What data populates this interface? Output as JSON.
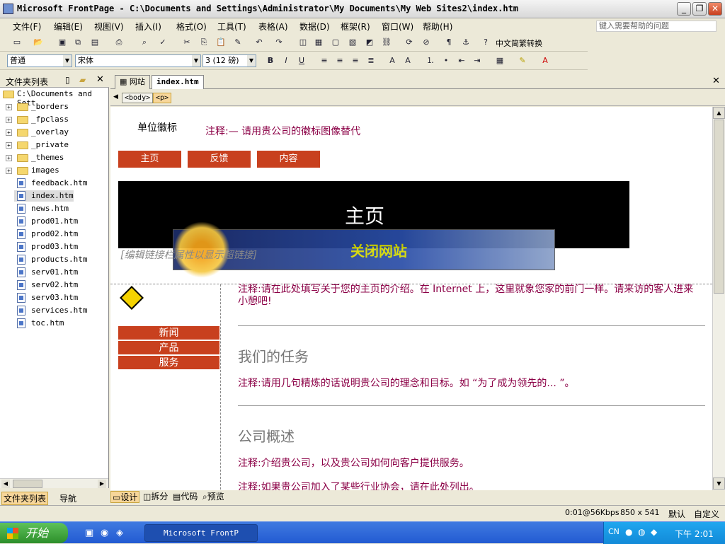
{
  "window": {
    "title": "Microsoft FrontPage - C:\\Documents and Settings\\Administrator\\My Documents\\My Web Sites2\\index.htm"
  },
  "menu": {
    "items": [
      "文件(F)",
      "编辑(E)",
      "视图(V)",
      "插入(I)",
      "格式(O)",
      "工具(T)",
      "表格(A)",
      "数据(D)",
      "框架(R)",
      "窗口(W)",
      "帮助(H)"
    ],
    "help_placeholder": "键入需要帮助的问题"
  },
  "toolbar": {
    "convert_label": "中文简繁转换"
  },
  "formatting": {
    "style": "普通",
    "font": "宋体",
    "size": "3 (12 磅)"
  },
  "folder_panel": {
    "title": "文件夹列表",
    "root": "C:\\Documents and Sett",
    "folders": [
      "_borders",
      "_fpclass",
      "_overlay",
      "_private",
      "_themes",
      "images"
    ],
    "files": [
      "feedback.htm",
      "index.htm",
      "news.htm",
      "prod01.htm",
      "prod02.htm",
      "prod03.htm",
      "products.htm",
      "serv01.htm",
      "serv02.htm",
      "serv03.htm",
      "services.htm",
      "toc.htm"
    ],
    "bottom_tabs": [
      "文件夹列表",
      "导航"
    ]
  },
  "doc_tabs": [
    "网站",
    "index.htm"
  ],
  "breadcrumb": [
    "<body>",
    "<p>"
  ],
  "page": {
    "logo_label": "单位徽标",
    "logo_note": "注释:— 请用贵公司的徽标图像替代",
    "top_nav": [
      "主页",
      "反馈",
      "内容"
    ],
    "banner_title": "主页",
    "overlay_text": "关闭网站",
    "edit_link_hint": "[编辑链接栏属性以显示超链接]",
    "side_nav": [
      "新闻",
      "产品",
      "服务"
    ],
    "intro_note": "注释:请在此处填写关于您的主页的介绍。在 Internet 上，这里就象您家的前门一样。请来访的客人进来小憩吧!",
    "section1_heading": "我们的任务",
    "section1_note": "注释:请用几句精炼的话说明贵公司的理念和目标。如 “为了成为领先的... ”。",
    "section2_heading": "公司概述",
    "section2_note1": "注释:介绍贵公司，以及贵公司如何向客户提供服务。",
    "section2_note2": "注释:如果贵公司加入了某些行业协会，请在此处列出。"
  },
  "view_tabs": [
    "设计",
    "拆分",
    "代码",
    "预览"
  ],
  "status": {
    "speed": "0:01@56Kbps",
    "dimensions": "850 x 541",
    "mode1": "默认",
    "mode2": "自定义"
  },
  "taskbar": {
    "start_label": "开始",
    "task_label": "Microsoft FrontP",
    "clock": "下午 2:01"
  },
  "colors": {
    "nav_red": "#c8401e",
    "note_color": "#8b0046",
    "banner_bg": "#000000",
    "taskbar_blue": "#225ad2"
  }
}
